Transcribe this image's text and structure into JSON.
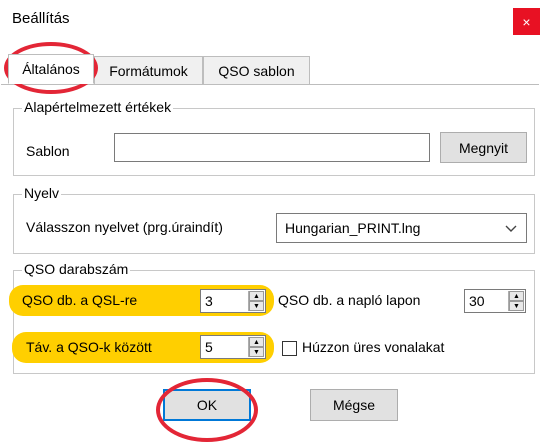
{
  "window": {
    "title": "Beállítás",
    "close_glyph": "×"
  },
  "tabs": [
    {
      "label": "Általános",
      "active": true
    },
    {
      "label": "Formátumok",
      "active": false
    },
    {
      "label": "QSO sablon",
      "active": false
    }
  ],
  "defaults_group": {
    "legend": "Alapértelmezett értékek",
    "template_label": "Sablon",
    "template_value": "",
    "open_button": "Megnyit"
  },
  "language_group": {
    "legend": "Nyelv",
    "prompt": "Válasszon nyelvet (prg.úraindít)",
    "selected": "Hungarian_PRINT.lng"
  },
  "qso_group": {
    "legend": "QSO darabszám",
    "per_qsl_label": "QSO db. a QSL-re",
    "per_qsl_value": "3",
    "per_log_page_label": "QSO db. a napló lapon",
    "per_log_page_value": "30",
    "spacing_label": "Táv. a QSO-k között",
    "spacing_value": "5",
    "empty_lines_label": "Húzzon üres vonalakat",
    "empty_lines_checked": false
  },
  "buttons": {
    "ok": "OK",
    "cancel": "Mégse"
  },
  "colors": {
    "highlight": "#ffcf00",
    "annotation_ring": "#e32636",
    "close": "#e81123",
    "ok_border": "#0078d7"
  }
}
